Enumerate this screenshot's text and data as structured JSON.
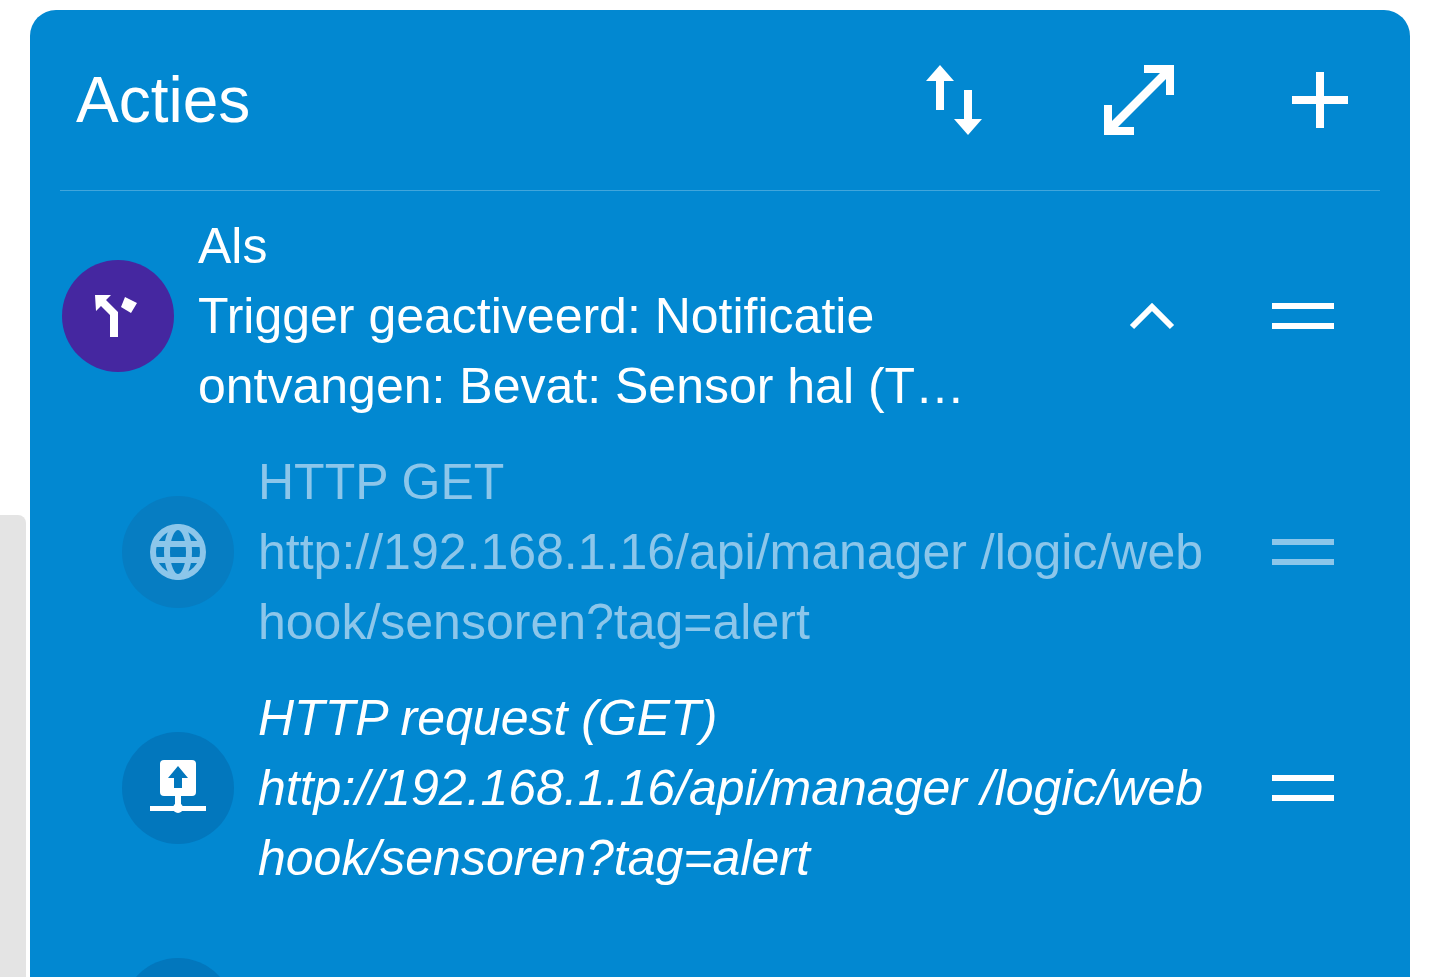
{
  "title": "Acties",
  "items": [
    {
      "kind": "condition",
      "heading": "Als",
      "text": "Trigger geactiveerd: Notificatie ontvangen: Bevat: Sensor hal (T…",
      "expanded": true,
      "children": [
        {
          "kind": "http-get",
          "heading": "HTTP GET",
          "text": "http://192.168.1.16/api/manager /logic/webhook/sensoren?tag=alert",
          "disabled": true
        },
        {
          "kind": "http-request",
          "heading": "HTTP request (GET)",
          "text": "http://192.168.1.16/api/manager /logic/webhook/sensoren?tag=alert",
          "disabled": false
        }
      ]
    }
  ]
}
